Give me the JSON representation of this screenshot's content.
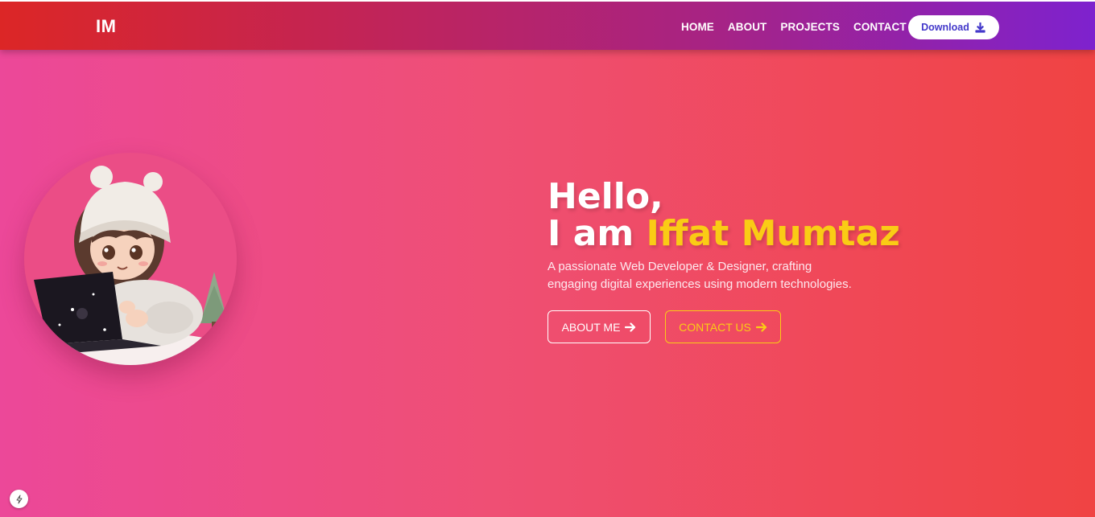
{
  "header": {
    "logo": "IM",
    "nav": [
      {
        "label": "HOME"
      },
      {
        "label": "ABOUT"
      },
      {
        "label": "PROJECTS"
      },
      {
        "label": "CONTACT"
      }
    ],
    "download_label": "Download",
    "download_icon": "download-icon"
  },
  "hero": {
    "greeting": "Hello,",
    "intro": "I am ",
    "name": "Iffat Mumtaz",
    "subtitle_line1": "A passionate Web Developer & Designer, crafting",
    "subtitle_line2": "engaging digital experiences using modern technologies.",
    "about_button": "ABOUT ME",
    "contact_button": "CONTACT US",
    "arrow_icon": "arrow-right-icon"
  },
  "colors": {
    "accent": "#facc15",
    "header_start": "#dc2626",
    "header_end": "#7e22ce",
    "download_text": "#4338ca"
  },
  "corner_icon": "bolt-icon"
}
